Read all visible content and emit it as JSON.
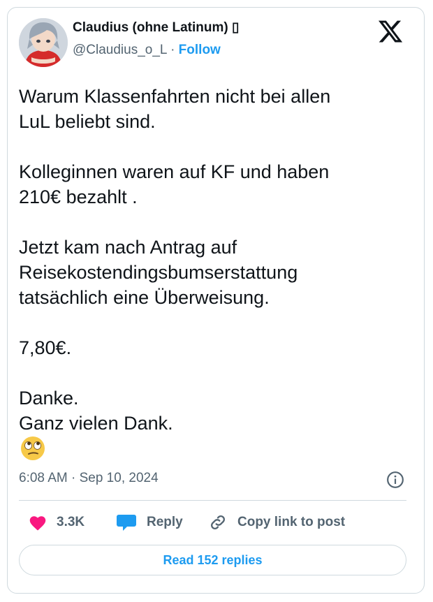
{
  "author": {
    "name": "Claudius (ohne Latinum)",
    "name_suffix_glyph": "▯",
    "handle": "@Claudius_o_L",
    "separator": "·",
    "follow_label": "Follow"
  },
  "post": {
    "lines": [
      "Warum Klassenfahrten nicht bei allen",
      "LuL beliebt sind.",
      "Kolleginnen waren auf KF und haben",
      "210€ bezahlt .",
      "Jetzt kam nach Antrag auf",
      "Reisekostendingsbumserstattung",
      "tatsächlich eine Überweisung.",
      "7,80€.",
      "Danke.",
      "Ganz vielen Dank."
    ],
    "emoji": "face-with-rolling-eyes",
    "timestamp": "6:08 AM · Sep 10, 2024"
  },
  "actions": {
    "like_count": "3.3K",
    "reply_label": "Reply",
    "copy_label": "Copy link to post"
  },
  "read_replies_label": "Read 152 replies",
  "colors": {
    "accent": "#1d9bf0",
    "like": "#f91880",
    "text": "#0f1419",
    "muted": "#536471",
    "border": "#cfd9de"
  },
  "icons": [
    "x-logo-icon",
    "info-icon",
    "heart-icon",
    "reply-bubble-icon",
    "link-icon"
  ]
}
